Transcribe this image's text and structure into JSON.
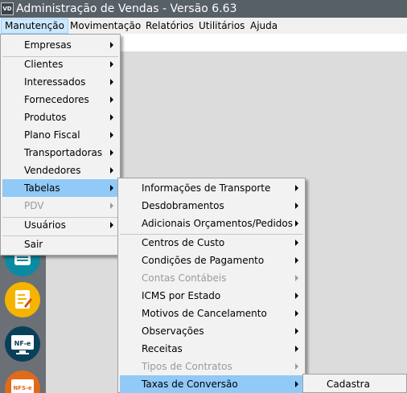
{
  "window": {
    "icon_label": "VD",
    "title": "Administração de Vendas - Versão 6.63"
  },
  "menubar": {
    "items": [
      {
        "label": "Manutenção"
      },
      {
        "label": "Movimentação"
      },
      {
        "label": "Relatórios"
      },
      {
        "label": "Utilitários"
      },
      {
        "label": "Ajuda"
      }
    ]
  },
  "sidebar": {
    "nfe_label": "NF-e",
    "nfse_label": "NFS-e",
    "colors": {
      "teal": "#0b8ba3",
      "yellow": "#f5b400",
      "navy": "#08405a",
      "orange": "#e06a1a"
    }
  },
  "menu_manutencao": {
    "items": [
      {
        "label": "Empresas",
        "submenu": true
      },
      {
        "label": "Clientes",
        "submenu": true
      },
      {
        "label": "Interessados",
        "submenu": true
      },
      {
        "label": "Fornecedores",
        "submenu": true
      },
      {
        "label": "Produtos",
        "submenu": true
      },
      {
        "label": "Plano Fiscal",
        "submenu": true
      },
      {
        "label": "Transportadoras",
        "submenu": true
      },
      {
        "label": "Vendedores",
        "submenu": true
      },
      {
        "label": "Tabelas",
        "submenu": true,
        "highlighted": true
      },
      {
        "label": "PDV",
        "submenu": true,
        "disabled": true
      },
      {
        "label": "Usuários",
        "submenu": true
      },
      {
        "label": "Sair"
      }
    ]
  },
  "menu_tabelas": {
    "items": [
      {
        "label": "Informações de Transporte",
        "submenu": true
      },
      {
        "label": "Desdobramentos",
        "submenu": true
      },
      {
        "label": "Adicionais Orçamentos/Pedidos",
        "submenu": true
      },
      {
        "label": "Centros de Custo",
        "submenu": true
      },
      {
        "label": "Condições de Pagamento",
        "submenu": true
      },
      {
        "label": "Contas Contábeis",
        "submenu": true,
        "disabled": true
      },
      {
        "label": "ICMS por Estado",
        "submenu": true
      },
      {
        "label": "Motivos de Cancelamento",
        "submenu": true
      },
      {
        "label": "Observações",
        "submenu": true
      },
      {
        "label": "Receitas",
        "submenu": true
      },
      {
        "label": "Tipos de Contratos",
        "submenu": true,
        "disabled": true
      },
      {
        "label": "Taxas de Conversão",
        "submenu": true,
        "highlighted": true
      }
    ]
  },
  "menu_taxas": {
    "items": [
      {
        "label": "Cadastra"
      }
    ]
  },
  "colors": {
    "titlebar": "#575f67",
    "menubar": "#f0f0f0",
    "menu_bg": "#f2f2f2",
    "highlight": "#91c9f7",
    "disabled_text": "#9a9a9a"
  }
}
